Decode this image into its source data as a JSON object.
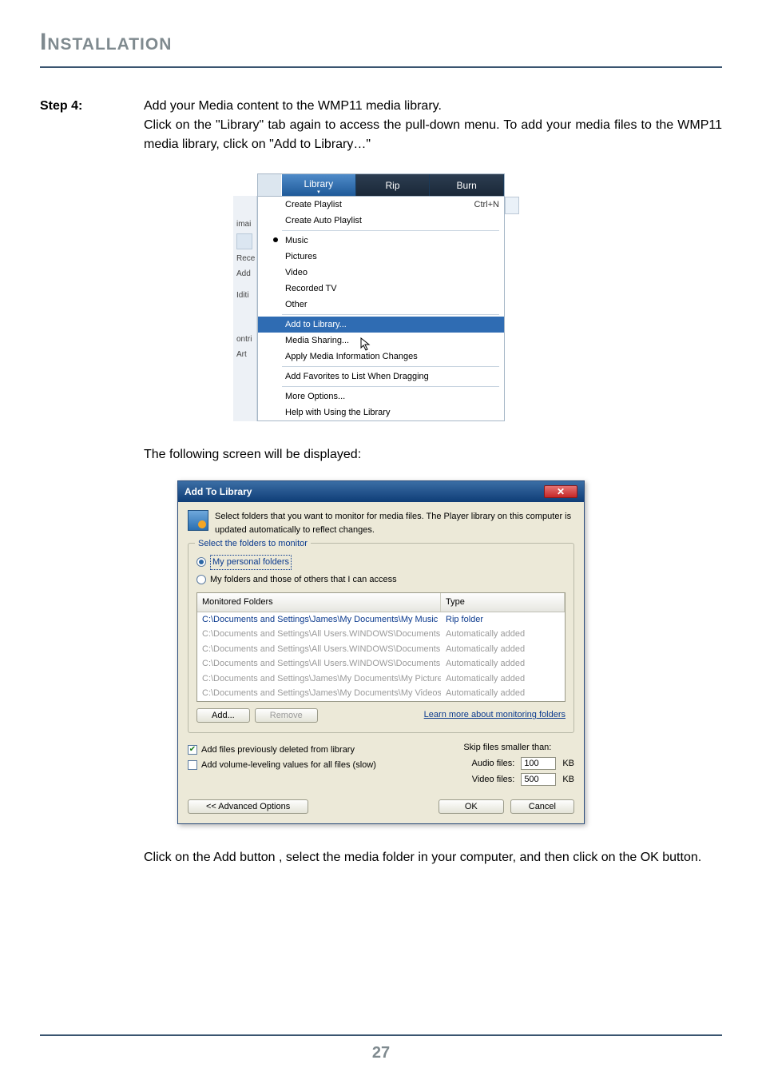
{
  "doc": {
    "heading": "Installation",
    "step_label": "Step 4:",
    "step_line1": "Add your Media content to the WMP11 media library.",
    "step_line2": "Click on the \"Library\" tab again to access the pull-down menu. To add your media files to the WMP11 media library, click on \"Add to Library…\"",
    "mid_text": "The following screen will be displayed:",
    "final_text": "Click on the Add button , select the media folder in your computer, and then click on the OK button.",
    "page_number": "27"
  },
  "wmp": {
    "tabs": {
      "library": "Library",
      "rip": "Rip",
      "burn": "Burn"
    },
    "left_labels": {
      "imai": "imai",
      "rece": "Rece",
      "add": "Add",
      "iditi": "Iditi",
      "ontri": "ontri",
      "art": "Art"
    },
    "rows": {
      "create_playlist": "Create Playlist",
      "create_playlist_shortcut": "Ctrl+N",
      "create_auto_playlist": "Create Auto Playlist",
      "music": "Music",
      "pictures": "Pictures",
      "video": "Video",
      "recorded_tv": "Recorded TV",
      "other": "Other",
      "add_to_library": "Add to Library...",
      "media_sharing": "Media Sharing...",
      "apply_media_info": "Apply Media Information Changes",
      "add_favorites": "Add Favorites to List When Dragging",
      "more_options": "More Options...",
      "help_library": "Help with Using the Library"
    }
  },
  "atl": {
    "title": "Add To Library",
    "intro": "Select folders that you want to monitor for media files. The Player library on this computer is updated automatically to reflect changes.",
    "group_title": "Select the folders to monitor",
    "radio1": "My personal folders",
    "radio2": "My folders and those of others that I can access",
    "col1": "Monitored Folders",
    "col2": "Type",
    "rows": [
      {
        "path": "C:\\Documents and Settings\\James\\My Documents\\My Music",
        "type": "Rip folder",
        "style": "selected"
      },
      {
        "path": "C:\\Documents and Settings\\All Users.WINDOWS\\Documents...",
        "type": "Automatically added",
        "style": "dim"
      },
      {
        "path": "C:\\Documents and Settings\\All Users.WINDOWS\\Documents...",
        "type": "Automatically added",
        "style": "dim"
      },
      {
        "path": "C:\\Documents and Settings\\All Users.WINDOWS\\Documents...",
        "type": "Automatically added",
        "style": "dim"
      },
      {
        "path": "C:\\Documents and Settings\\James\\My Documents\\My Pictures",
        "type": "Automatically added",
        "style": "dim"
      },
      {
        "path": "C:\\Documents and Settings\\James\\My Documents\\My Videos",
        "type": "Automatically added",
        "style": "dim"
      }
    ],
    "add_btn": "Add...",
    "remove_btn": "Remove",
    "learn_more": "Learn more about monitoring folders",
    "check1": "Add files previously deleted from library",
    "check2": "Add volume-leveling values for all files (slow)",
    "skip_label": "Skip files smaller than:",
    "audio_label": "Audio files:",
    "audio_value": "100",
    "video_label": "Video files:",
    "video_value": "500",
    "kb": "KB",
    "adv_btn": "<< Advanced Options",
    "ok_btn": "OK",
    "cancel_btn": "Cancel"
  }
}
